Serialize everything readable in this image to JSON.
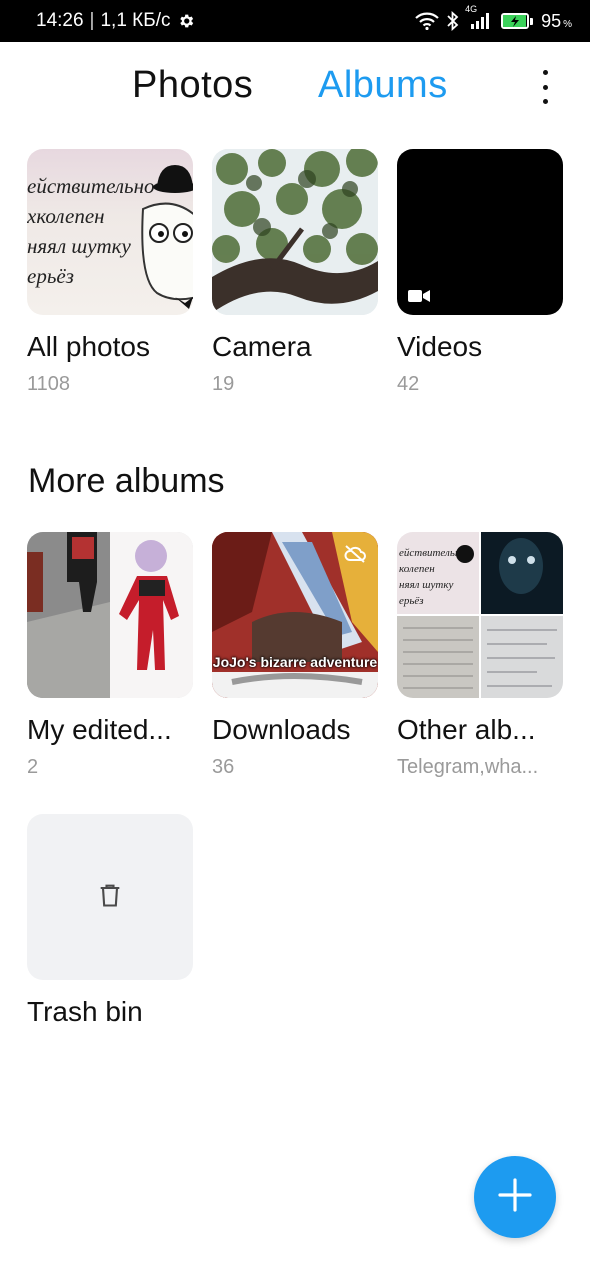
{
  "status_bar": {
    "time": "14:26",
    "speed": "1,1 КБ/с",
    "network": "4G",
    "battery_level": "95",
    "battery_pct_sign": "%"
  },
  "header": {
    "tabs": [
      {
        "label": "Photos",
        "active": false
      },
      {
        "label": "Albums",
        "active": true
      }
    ],
    "accent_color": "#1d9bf0"
  },
  "top_albums": [
    {
      "name": "All photos",
      "count": "1108"
    },
    {
      "name": "Camera",
      "count": "19"
    },
    {
      "name": "Videos",
      "count": "42"
    }
  ],
  "more_albums_title": "More albums",
  "more_albums": [
    {
      "name": "My edited...",
      "count": "2"
    },
    {
      "name": "Downloads",
      "count": "36"
    },
    {
      "name": "Other alb...",
      "count": "Telegram,wha..."
    },
    {
      "name": "Trash bin",
      "count": ""
    }
  ],
  "thumbnail_text": {
    "meme_lines": [
      "ействительно",
      "хколепен",
      "няял шутку",
      "ерьёз"
    ],
    "jojo_caption": "JoJo's bizarre adventure"
  }
}
